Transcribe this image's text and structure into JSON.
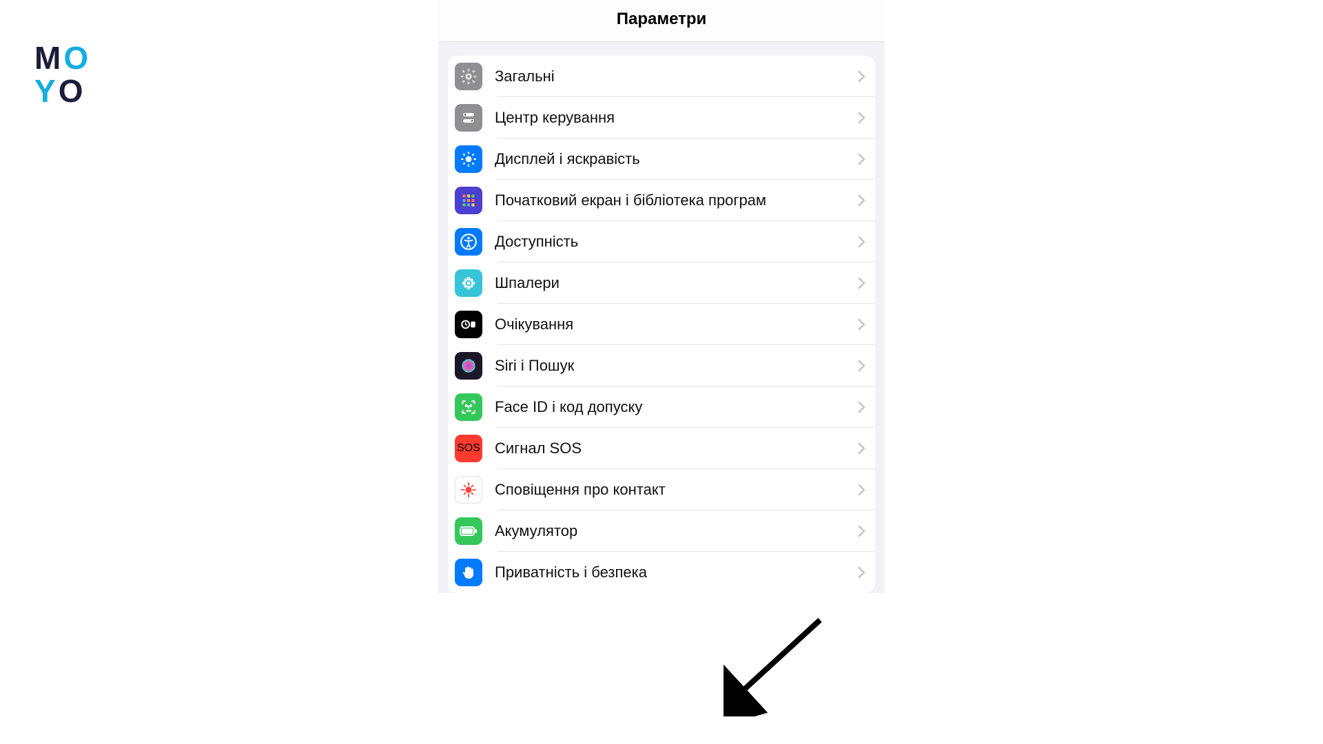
{
  "logo": {
    "line1_m": "M",
    "line1_o": "O",
    "line2_y": "Y",
    "line2_o": "O"
  },
  "header": {
    "title": "Параметри"
  },
  "items": [
    {
      "key": "general",
      "label": "Загальні",
      "iconBg": "#8e8e93"
    },
    {
      "key": "control-center",
      "label": "Центр керування",
      "iconBg": "#8e8e93"
    },
    {
      "key": "display",
      "label": "Дисплей і яскравість",
      "iconBg": "#007aff"
    },
    {
      "key": "home-screen",
      "label": "Початковий екран і бібліотека програм",
      "iconBg": "#4c3fd1"
    },
    {
      "key": "accessibility",
      "label": "Доступність",
      "iconBg": "#007aff"
    },
    {
      "key": "wallpaper",
      "label": "Шпалери",
      "iconBg": "#37c4d8"
    },
    {
      "key": "standby",
      "label": "Очікування",
      "iconBg": "#000000"
    },
    {
      "key": "siri-search",
      "label": "Siri і Пошук",
      "iconBg": "#1b1728"
    },
    {
      "key": "faceid",
      "label": "Face ID і код допуску",
      "iconBg": "#34c759"
    },
    {
      "key": "sos",
      "label": "Сигнал SOS",
      "iconBg": "#ff3b30",
      "badgeText": "SOS"
    },
    {
      "key": "exposure",
      "label": "Сповіщення про контакт",
      "iconBg": "#ffffff",
      "iconBorder": true
    },
    {
      "key": "battery",
      "label": "Акумулятор",
      "iconBg": "#34c759"
    },
    {
      "key": "privacy",
      "label": "Приватність і безпека",
      "iconBg": "#007aff"
    }
  ]
}
